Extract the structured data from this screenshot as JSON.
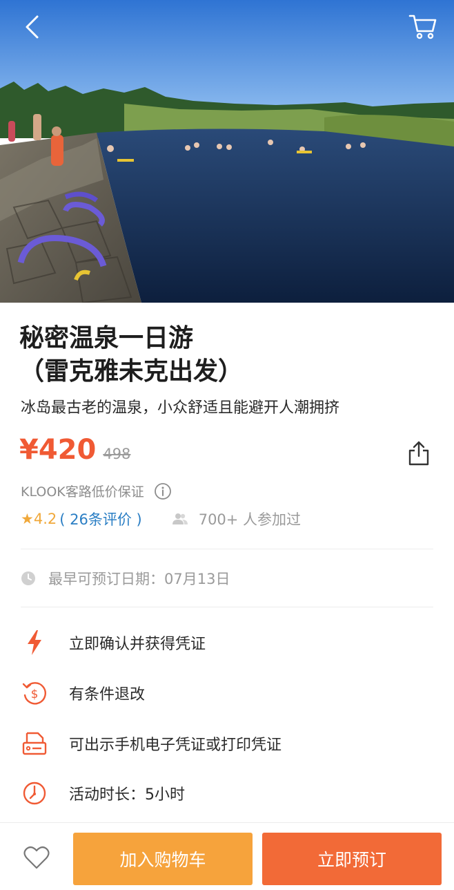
{
  "nav": {
    "back_icon": "chevron-left-icon",
    "cart_icon": "shopping-cart-icon"
  },
  "product": {
    "title_line1": "秘密温泉一日游",
    "title_line2": "（雷克雅未克出发）",
    "subtitle": "冰岛最古老的温泉，小众舒适且能避开人潮拥挤"
  },
  "pricing": {
    "price": "¥420",
    "original_price": "498",
    "price_color": "#f05a34"
  },
  "guarantee": {
    "text": "KLOOK客路低价保证"
  },
  "rating": {
    "star": "★",
    "score": "4.2",
    "reviews": "( 26条评价 )",
    "participants": "700+ 人参加过"
  },
  "booking": {
    "earliest_date": "最早可预订日期：07月13日"
  },
  "features": [
    {
      "icon": "lightning-icon",
      "text": "立即确认并获得凭证"
    },
    {
      "icon": "refund-dollar-icon",
      "text": "有条件退改"
    },
    {
      "icon": "ticket-printer-icon",
      "text": "可出示手机电子凭证或打印凭证"
    },
    {
      "icon": "clock-icon",
      "text": "活动时长：5小时"
    }
  ],
  "bottom": {
    "add_to_cart": "加入购物车",
    "book_now": "立即预订",
    "cart_color": "#f6a33c",
    "book_color": "#f26a37"
  }
}
